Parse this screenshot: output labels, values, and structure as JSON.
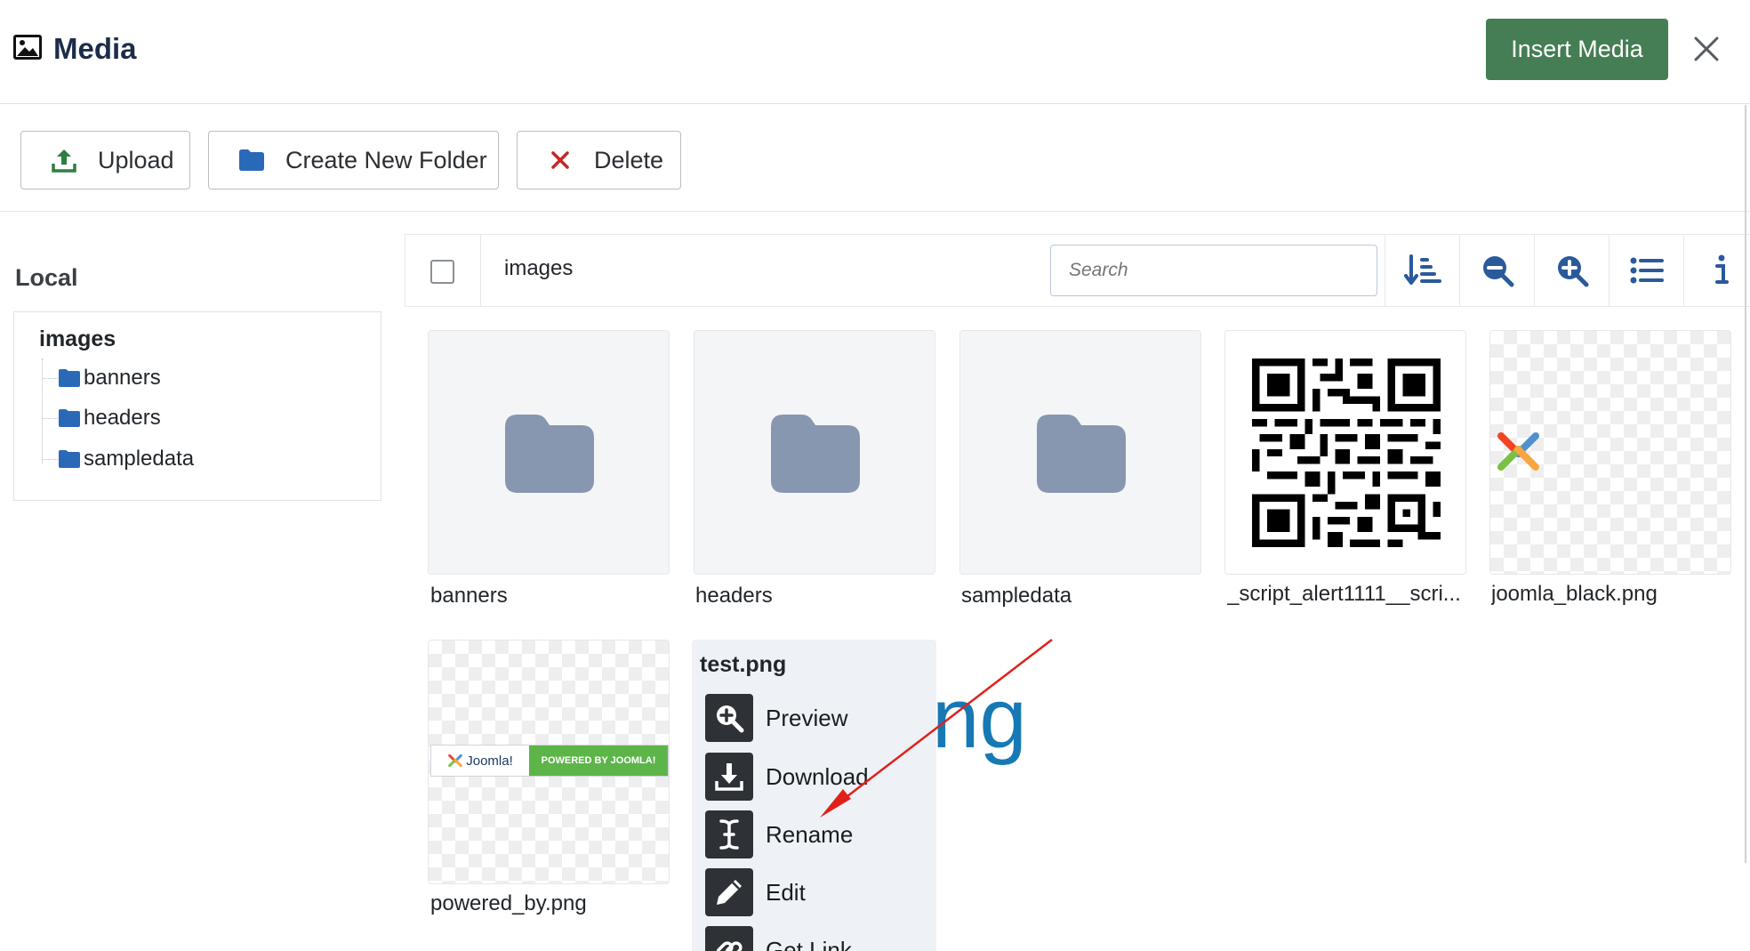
{
  "header": {
    "title": "Media",
    "insert_label": "Insert Media"
  },
  "toolbar": {
    "upload_label": "Upload",
    "new_folder_label": "Create New Folder",
    "delete_label": "Delete"
  },
  "sidebar": {
    "title": "Local",
    "root": "images",
    "items": [
      {
        "label": "banners"
      },
      {
        "label": "headers"
      },
      {
        "label": "sampledata"
      }
    ]
  },
  "browser": {
    "breadcrumb": "images",
    "search_placeholder": "Search",
    "header_icons": [
      "sort-icon",
      "zoom-out-icon",
      "zoom-in-icon",
      "list-view-icon",
      "info-icon"
    ]
  },
  "items": [
    {
      "name": "banners",
      "kind": "folder"
    },
    {
      "name": "headers",
      "kind": "folder"
    },
    {
      "name": "sampledata",
      "kind": "folder"
    },
    {
      "name": "_script_alert1111__scri...",
      "kind": "image"
    },
    {
      "name": "joomla_black.png",
      "kind": "image"
    },
    {
      "name": "powered_by.png",
      "kind": "image"
    }
  ],
  "powered_by_badge": {
    "logo_text": "Joomla!",
    "badge_text": "POWERED BY JOOMLA!"
  },
  "context_menu": {
    "file": "test.png",
    "background_text": "ng",
    "actions": [
      {
        "label": "Preview",
        "icon": "preview-icon"
      },
      {
        "label": "Download",
        "icon": "download-icon"
      },
      {
        "label": "Rename",
        "icon": "rename-icon"
      },
      {
        "label": "Edit",
        "icon": "edit-icon"
      },
      {
        "label": "Get Link",
        "icon": "link-icon"
      }
    ]
  },
  "colors": {
    "accent_green": "#457d54",
    "folder_blue": "#2a69b8",
    "folder_tile": "#8797b0",
    "delete_red": "#c52827",
    "annotation_red": "#e0211b"
  }
}
